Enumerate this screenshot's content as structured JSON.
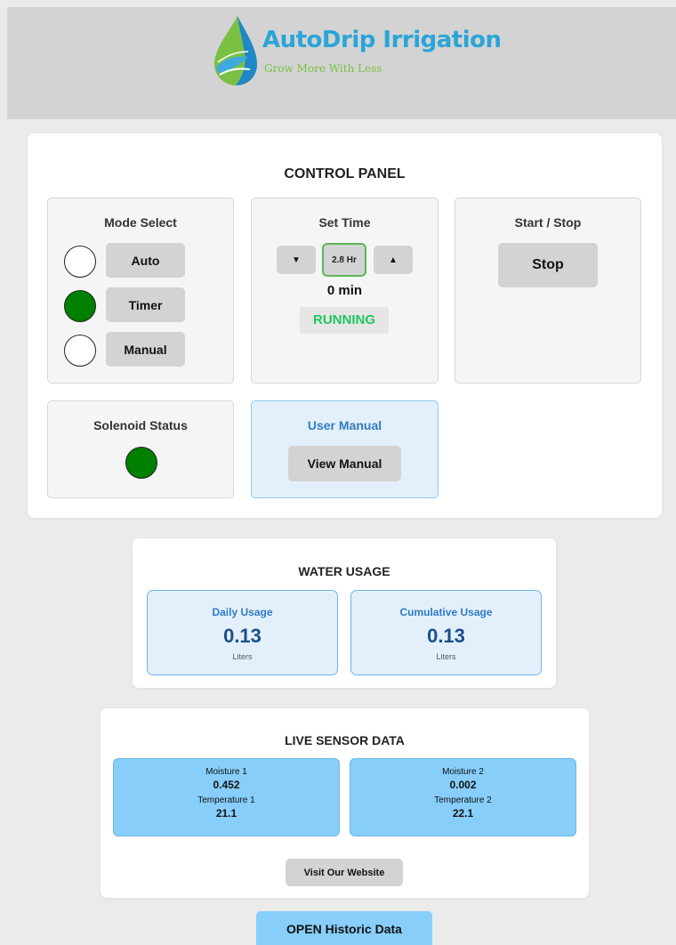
{
  "brand": {
    "name": "AutoDrip Irrigation",
    "tagline": "Grow More With Less",
    "colors": {
      "title": "#2aa5d8",
      "tagline": "#7ac143"
    }
  },
  "control_panel": {
    "title": "CONTROL PANEL",
    "mode_select": {
      "title": "Mode Select",
      "options": [
        {
          "label": "Auto",
          "selected": false
        },
        {
          "label": "Timer",
          "selected": true
        },
        {
          "label": "Manual",
          "selected": false
        }
      ]
    },
    "set_time": {
      "title": "Set Time",
      "decrement_icon": "▼",
      "increment_icon": "▲",
      "value": "2.8 Hr",
      "remaining": "0 min",
      "status": "RUNNING",
      "status_color": "#22c55e"
    },
    "start_stop": {
      "title": "Start / Stop",
      "button_label": "Stop"
    },
    "solenoid": {
      "title": "Solenoid Status",
      "state": "on",
      "color": "#008000"
    },
    "user_manual": {
      "title": "User Manual",
      "button_label": "View Manual"
    }
  },
  "water_usage": {
    "title": "WATER USAGE",
    "daily": {
      "label": "Daily Usage",
      "value": "0.13",
      "unit": "Liters"
    },
    "cumulative": {
      "label": "Cumulative Usage",
      "value": "0.13",
      "unit": "Liters"
    }
  },
  "sensor_data": {
    "title": "LIVE SENSOR DATA",
    "sensors": [
      {
        "moisture_label": "Moisture 1",
        "moisture_value": "0.452",
        "temp_label": "Temperature 1",
        "temp_value": "21.1"
      },
      {
        "moisture_label": "Moisture 2",
        "moisture_value": "0.002",
        "temp_label": "Temperature 2",
        "temp_value": "22.1"
      }
    ],
    "website_button": "Visit Our Website"
  },
  "historic_button": "OPEN Historic Data"
}
